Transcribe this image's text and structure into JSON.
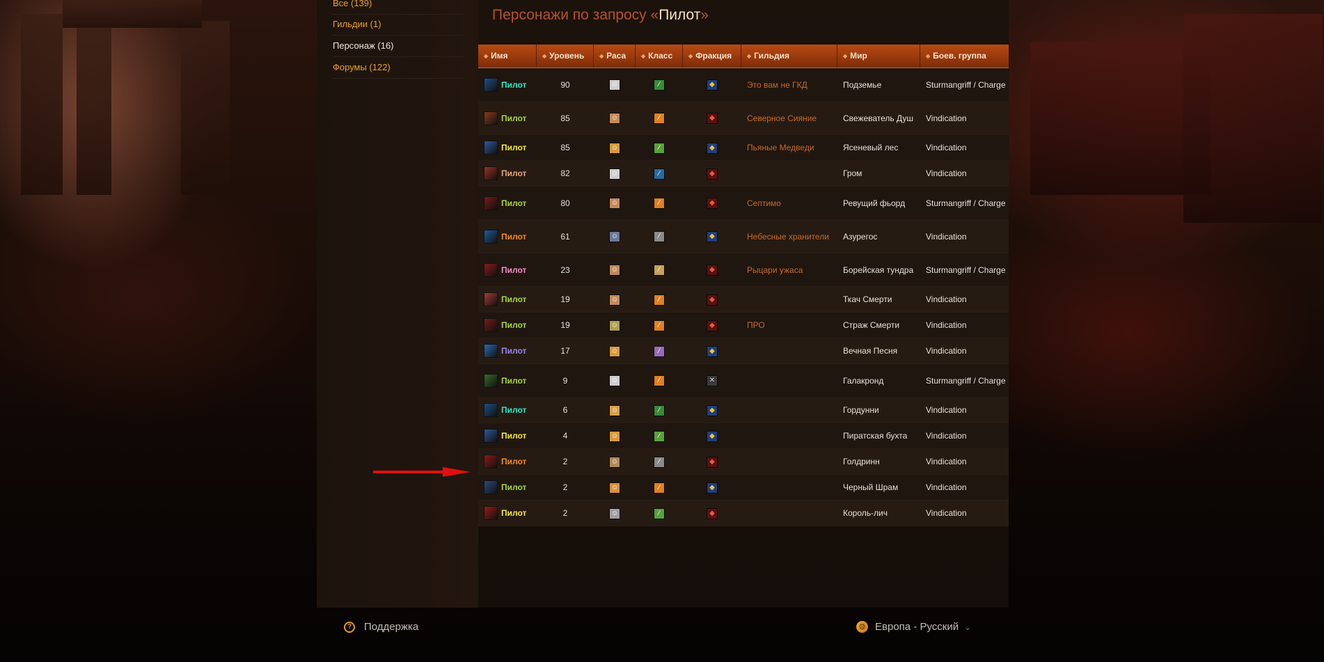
{
  "sidebar": {
    "items": [
      {
        "label": "Все (139)",
        "active": false
      },
      {
        "label": "Гильдии (1)",
        "active": false
      },
      {
        "label": "Персонаж (16)",
        "active": true
      },
      {
        "label": "Форумы (122)",
        "active": false
      }
    ]
  },
  "heading": {
    "prefix": "Персонажи по запросу «",
    "query": "Пилот",
    "suffix": "»"
  },
  "table": {
    "columns": [
      "Имя",
      "Уровень",
      "Раса",
      "Класс",
      "Фракция",
      "Гильдия",
      "Мир",
      "Боев. группа"
    ],
    "rows": [
      {
        "name": "Пилот",
        "name_color": "#2ee6c0",
        "level": "90",
        "guild": "Это вам не ГКД",
        "realm": "Подземье",
        "battlegroup": "Sturmangriff / Charge",
        "faction": "alliance",
        "avatar": "#1d4f86",
        "race": "#cfcfcf",
        "cls": "#3a8a3a",
        "h": 47
      },
      {
        "name": "Пилот",
        "name_color": "#a7d34a",
        "level": "85",
        "guild": "Северное Сияние",
        "realm": "Свежеватель Душ",
        "battlegroup": "Vindication",
        "faction": "horde",
        "avatar": "#8a3a1a",
        "race": "#c58a5a",
        "cls": "#e08020",
        "h": 47
      },
      {
        "name": "Пилот",
        "name_color": "#f4e64a",
        "level": "85",
        "guild": "Пьяные Медведи",
        "realm": "Ясеневый лес",
        "battlegroup": "Vindication",
        "faction": "alliance",
        "avatar": "#2c5aa0",
        "race": "#d89a3a",
        "cls": "#5aa03a",
        "h": 36
      },
      {
        "name": "Пилот",
        "name_color": "#e9a57a",
        "level": "82",
        "guild": "",
        "realm": "Гром",
        "battlegroup": "Vindication",
        "faction": "horde",
        "avatar": "#9a3020",
        "race": "#cfcfcf",
        "cls": "#2a6aa0",
        "h": 36
      },
      {
        "name": "Пилот",
        "name_color": "#a7d34a",
        "level": "80",
        "guild": "Септимо",
        "realm": "Ревущий фьорд",
        "battlegroup": "Sturmangriff / Charge",
        "faction": "horde",
        "avatar": "#7a1a12",
        "race": "#c58a5a",
        "cls": "#e08020",
        "h": 47
      },
      {
        "name": "Пилот",
        "name_color": "#f08a2a",
        "level": "61",
        "guild": "Небесные хранители",
        "realm": "Азурегос",
        "battlegroup": "Vindication",
        "faction": "alliance",
        "avatar": "#1f5a9a",
        "race": "#6a7a9a",
        "cls": "#8a8a8a",
        "h": 47
      },
      {
        "name": "Пилот",
        "name_color": "#f38cc8",
        "level": "23",
        "guild": "Рыцари ужаса",
        "realm": "Борейская тундра",
        "battlegroup": "Sturmangriff / Charge",
        "faction": "horde",
        "avatar": "#8a1a1a",
        "race": "#c08a5a",
        "cls": "#c8a05a",
        "h": 47
      },
      {
        "name": "Пилот",
        "name_color": "#a7d34a",
        "level": "19",
        "guild": "",
        "realm": "Ткач Смерти",
        "battlegroup": "Vindication",
        "faction": "horde",
        "avatar": "#a83a30",
        "race": "#c58a5a",
        "cls": "#e08020",
        "h": 36
      },
      {
        "name": "Пилот",
        "name_color": "#a7d34a",
        "level": "19",
        "guild": "ПРО",
        "realm": "Страж Смерти",
        "battlegroup": "Vindication",
        "faction": "horde",
        "avatar": "#7a1a12",
        "race": "#b0a050",
        "cls": "#e08020",
        "h": 36
      },
      {
        "name": "Пилот",
        "name_color": "#9a88e6",
        "level": "17",
        "guild": "",
        "realm": "Вечная Песня",
        "battlegroup": "Vindication",
        "faction": "alliance",
        "avatar": "#2a6ab0",
        "race": "#d89a3a",
        "cls": "#9a6aba",
        "h": 36
      },
      {
        "name": "Пилот",
        "name_color": "#a7d34a",
        "level": "9",
        "guild": "",
        "realm": "Галакронд",
        "battlegroup": "Sturmangriff / Charge",
        "faction": "neutral",
        "avatar": "#3a6a2a",
        "race": "#cfcfcf",
        "cls": "#e08020",
        "h": 47
      },
      {
        "name": "Пилот",
        "name_color": "#2ee6c0",
        "level": "6",
        "guild": "",
        "realm": "Гордунни",
        "battlegroup": "Vindication",
        "faction": "alliance",
        "avatar": "#1d4f86",
        "race": "#d8a04a",
        "cls": "#3a8a3a",
        "h": 36
      },
      {
        "name": "Пилот",
        "name_color": "#f4e64a",
        "level": "4",
        "guild": "",
        "realm": "Пиратская бухта",
        "battlegroup": "Vindication",
        "faction": "alliance",
        "avatar": "#2a5a9a",
        "race": "#d89a3a",
        "cls": "#5aa03a",
        "h": 36
      },
      {
        "name": "Пилот",
        "name_color": "#f08a2a",
        "level": "2",
        "guild": "",
        "realm": "Голдринн",
        "battlegroup": "Vindication",
        "faction": "horde",
        "avatar": "#8a1a12",
        "race": "#b08a5a",
        "cls": "#8a8a8a",
        "h": 36
      },
      {
        "name": "Пилот",
        "name_color": "#a7d34a",
        "level": "2",
        "guild": "",
        "realm": "Черный Шрам",
        "battlegroup": "Vindication",
        "faction": "alliance",
        "avatar": "#2a4a7a",
        "race": "#d8903a",
        "cls": "#e08020",
        "h": 36
      },
      {
        "name": "Пилот",
        "name_color": "#f4e64a",
        "level": "2",
        "guild": "",
        "realm": "Король-лич",
        "battlegroup": "Vindication",
        "faction": "horde",
        "avatar": "#9a1a12",
        "race": "#a0a0a0",
        "cls": "#5aa03a",
        "h": 36
      }
    ]
  },
  "footer": {
    "support_label": "Поддержка",
    "region_label": "Европа - Русский"
  },
  "icons": {
    "sort": "triangle-sort-icon",
    "alliance": "alliance-faction-icon",
    "horde": "horde-faction-icon",
    "neutral": "neutral-faction-icon"
  },
  "colors": {
    "header_orange": "#b84a13",
    "link_orange": "#e9a128",
    "guild_orange": "#c96a2a",
    "arrow_red": "#e01010"
  }
}
